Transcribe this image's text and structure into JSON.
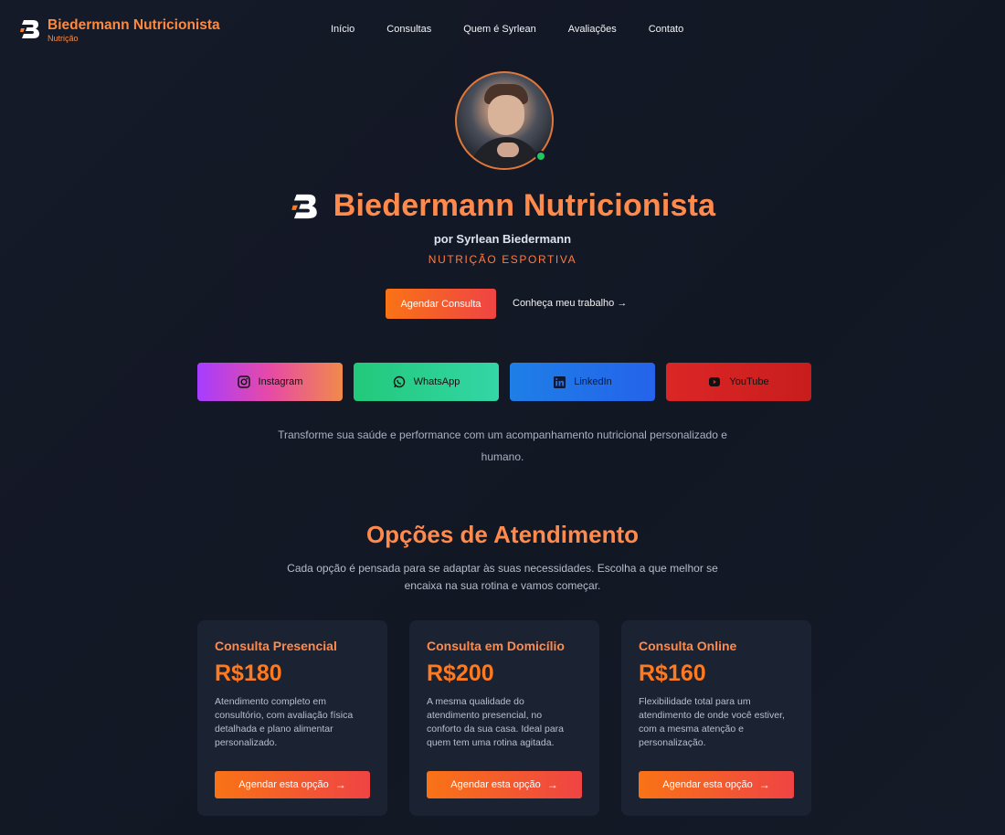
{
  "header": {
    "brand_name": "Biedermann Nutricionista",
    "brand_sub": "Nutrição",
    "nav": [
      "Início",
      "Consultas",
      "Quem é Syrlean",
      "Avaliações",
      "Contato"
    ]
  },
  "hero": {
    "title": "Biedermann Nutricionista",
    "by": "por Syrlean Biedermann",
    "tagline": "NUTRIÇÃO ESPORTIVA",
    "cta_primary": "Agendar Consulta",
    "cta_secondary": "Conheça meu trabalho →",
    "intro": "Transforme sua saúde e performance com um acompanhamento nutricional personalizado e humano."
  },
  "socials": [
    {
      "label": "Instagram",
      "icon": "instagram-icon"
    },
    {
      "label": "WhatsApp",
      "icon": "whatsapp-icon"
    },
    {
      "label": "LinkedIn",
      "icon": "linkedin-icon"
    },
    {
      "label": "YouTube",
      "icon": "youtube-icon"
    }
  ],
  "options": {
    "title": "Opções de Atendimento",
    "subtitle": "Cada opção é pensada para se adaptar às suas necessidades. Escolha a que melhor se encaixa na sua rotina e vamos começar.",
    "cards": [
      {
        "title": "Consulta Presencial",
        "price": "R$180",
        "description": "Atendimento completo em consultório, com avaliação física detalhada e plano alimentar personalizado.",
        "button": "Agendar esta opção"
      },
      {
        "title": "Consulta em Domicílio",
        "price": "R$200",
        "description": "A mesma qualidade do atendimento presencial, no conforto da sua casa. Ideal para quem tem uma rotina agitada.",
        "button": "Agendar esta opção"
      },
      {
        "title": "Consulta Online",
        "price": "R$160",
        "description": "Flexibilidade total para um atendimento de onde você estiver, com a mesma atenção e personalização.",
        "button": "Agendar esta opção"
      }
    ]
  },
  "colors": {
    "background": "#131826",
    "accent": "#ff8a4c",
    "price": "#ff7a1f",
    "card": "#1b2333",
    "online_status": "#22c55e"
  }
}
